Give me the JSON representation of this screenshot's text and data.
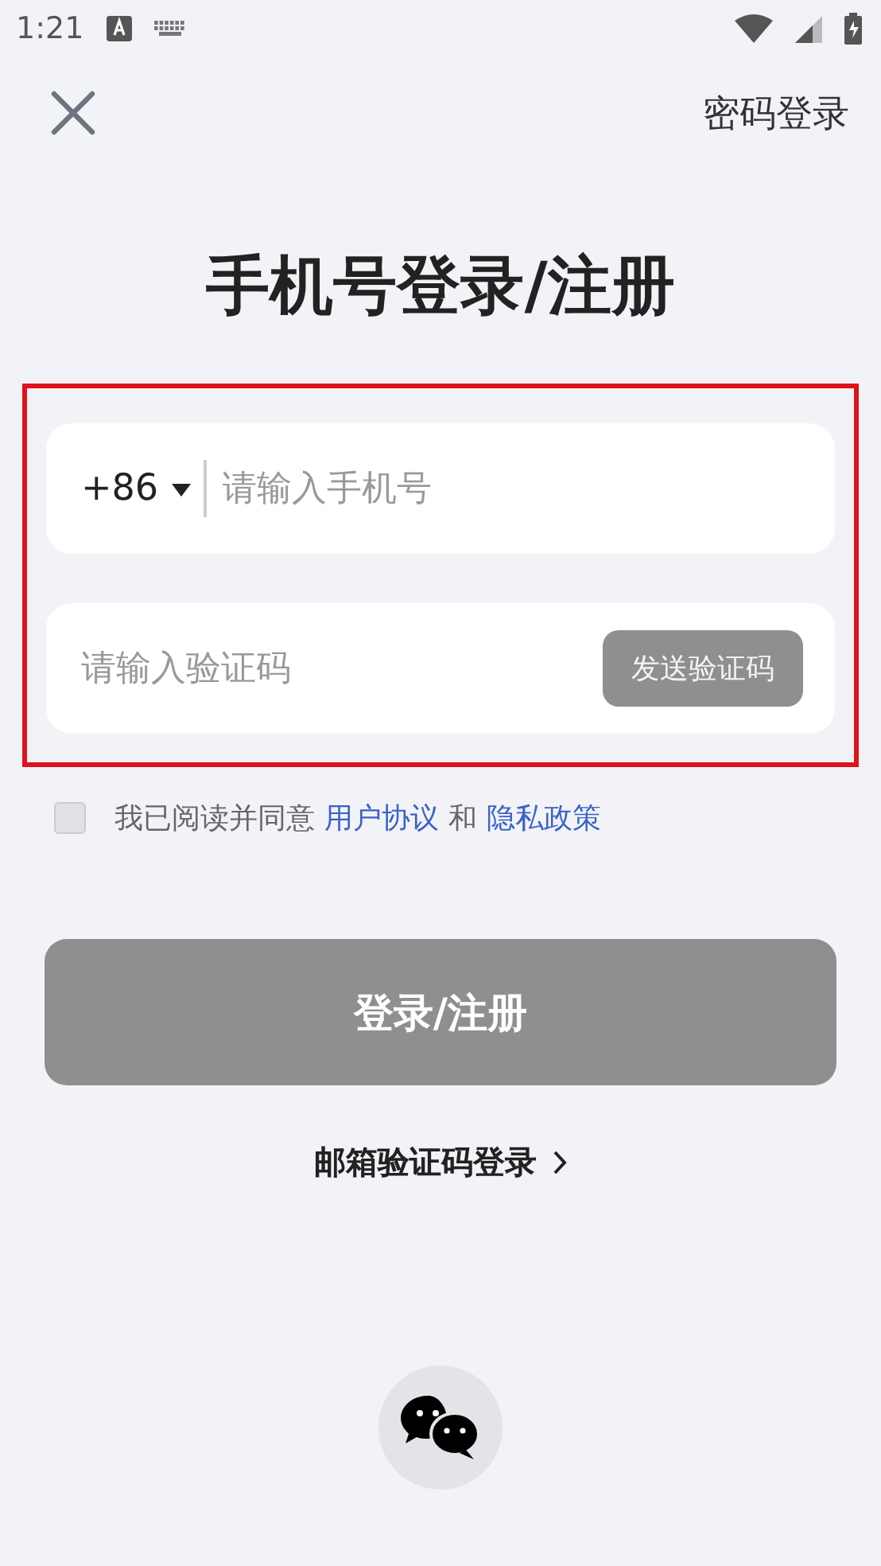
{
  "status_bar": {
    "time": "1:21"
  },
  "header": {
    "switch_link": "密码登录"
  },
  "title": "手机号登录/注册",
  "form": {
    "highlighted": true,
    "phone": {
      "country_code": "+86",
      "placeholder": "请输入手机号"
    },
    "code": {
      "placeholder": "请输入验证码",
      "send_button": "发送验证码",
      "send_disabled": true
    }
  },
  "agreement": {
    "checked": false,
    "prefix": "我已阅读并同意",
    "link_1": "用户协议",
    "joiner": "和",
    "link_2": "隐私政策"
  },
  "submit": {
    "label": "登录/注册",
    "disabled": true
  },
  "alt_login": {
    "label": "邮箱验证码登录"
  },
  "social": [
    {
      "kind": "wechat"
    }
  ]
}
